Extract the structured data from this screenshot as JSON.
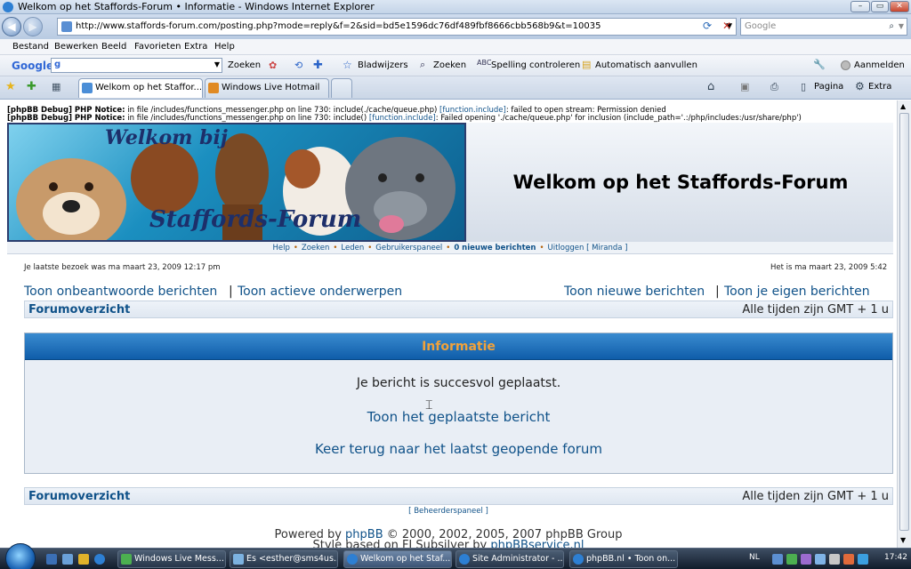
{
  "window": {
    "title": "Welkom op het Staffords-Forum • Informatie - Windows Internet Explorer"
  },
  "address_bar": {
    "url": "http://www.staffords-forum.com/posting.php?mode=reply&f=2&sid=bd5e1596dc76df489fbf8666cbb568b9&t=10035",
    "search_placeholder": "Google"
  },
  "menu": [
    "Bestand",
    "Bewerken",
    "Beeld",
    "Favorieten",
    "Extra",
    "Help"
  ],
  "google_toolbar": {
    "logo": "Google",
    "search_label": "Zoeken",
    "bookmarks": "Bladwijzers",
    "zoeken": "Zoeken",
    "spelling": "Spelling controleren",
    "autofill": "Automatisch aanvullen",
    "signin": "Aanmelden"
  },
  "tabs": [
    {
      "label": "Welkom op het Staffor...",
      "active": true
    },
    {
      "label": "Windows Live Hotmail",
      "active": false
    }
  ],
  "command_bar": {
    "page": "Pagina",
    "extra": "Extra"
  },
  "debug": {
    "line1_prefix": "[phpBB Debug] PHP Notice:",
    "line1_text": " in file /includes/functions_messenger.php on line 730: include(./cache/queue.php) ",
    "line1_link": "[function.include]",
    "line1_tail": ": failed to open stream: Permission denied",
    "line2_prefix": "[phpBB Debug] PHP Notice:",
    "line2_text": " in file /includes/functions_messenger.php on line 730: include() ",
    "line2_link": "[function.include]",
    "line2_tail": ": Failed opening './cache/queue.php' for inclusion (include_path='.:/php/includes:/usr/share/php')"
  },
  "banner": {
    "logo_text_top": "Welkom bij",
    "logo_text_bottom": "Staffords-Forum"
  },
  "site": {
    "title": "Welkom op het Staffords-Forum"
  },
  "navlinks": {
    "help": "Help",
    "zoeken": "Zoeken",
    "leden": "Leden",
    "cp": "Gebruikerspaneel",
    "newmsg": "0 nieuwe berichten",
    "logout": "Uitloggen [ Miranda ]"
  },
  "visit": {
    "last": "Je laatste bezoek was ma maart 23, 2009 12:17 pm",
    "now": "Het is ma maart 23, 2009 5:42"
  },
  "links": {
    "unanswered": "Toon onbeantwoorde berichten",
    "active": "Toon actieve onderwerpen",
    "new": "Toon nieuwe berichten",
    "own": "Toon je eigen berichten"
  },
  "crumbs": {
    "index": "Forumoverzicht",
    "tz": "Alle tijden zijn GMT + 1 u"
  },
  "info": {
    "header": "Informatie",
    "message": "Je bericht is succesvol geplaatst.",
    "link1": "Toon het geplaatste bericht",
    "link2": "Keer terug naar het laatst geopende forum"
  },
  "footer": {
    "admin": "[ Beheerderspaneel ]",
    "powered_prefix": "Powered by ",
    "powered_link": "phpBB",
    "powered_suffix": " © 2000, 2002, 2005, 2007 phpBB Group",
    "style_prefix": "Style based on FI Subsilver by ",
    "style_link": "phpBBservice.nl"
  },
  "taskbar": {
    "items": [
      {
        "label": "Windows Live Mess..."
      },
      {
        "label": "Es <esther@sms4us...."
      },
      {
        "label": "Welkom op het Staf..."
      },
      {
        "label": "Site Administrator - ..."
      },
      {
        "label": "phpBB.nl • Toon on..."
      }
    ],
    "lang": "NL",
    "clock": "17:42"
  },
  "colors": {
    "link": "#105289",
    "info_header_text": "#f0a23b",
    "info_header_bg": "#0f5da9"
  }
}
